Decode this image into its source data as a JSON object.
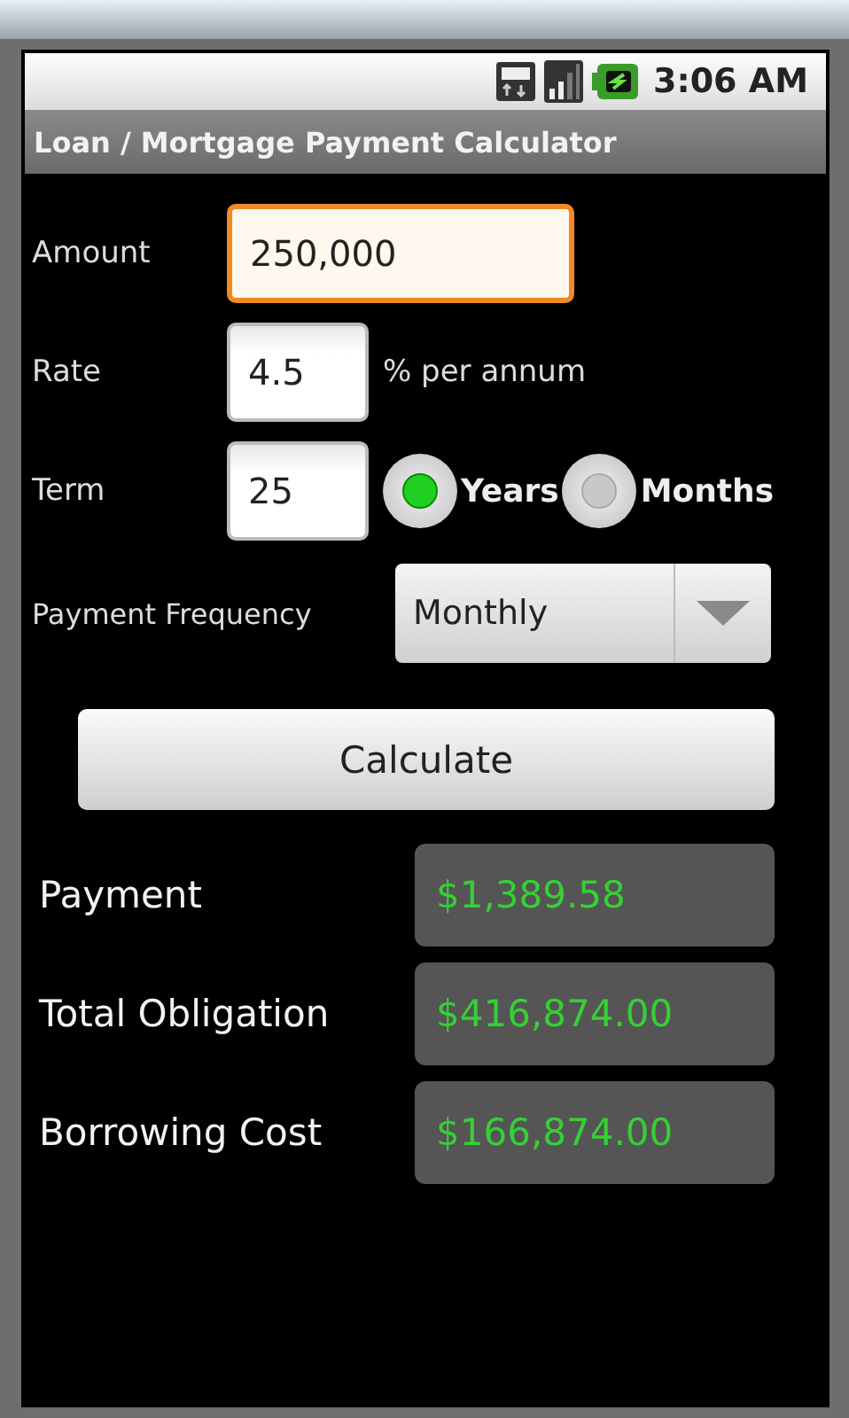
{
  "status_bar": {
    "time": "3:06 AM"
  },
  "title": "Loan / Mortgage Payment Calculator",
  "amount": {
    "label": "Amount",
    "value": "250,000",
    "focused": true
  },
  "rate": {
    "label": "Rate",
    "value": "4.5",
    "focused": false,
    "suffix": "% per annum"
  },
  "term": {
    "label": "Term",
    "value": "25",
    "focused": false
  },
  "term_units": [
    {
      "label": "Years",
      "selected": true
    },
    {
      "label": "Months",
      "selected": false
    }
  ],
  "frequency": {
    "label": "Payment Frequency",
    "value": "Monthly"
  },
  "calculate_button": "Calculate",
  "results": [
    {
      "label": "Payment",
      "value": "$1,389.58"
    },
    {
      "label": "Total Obligation",
      "value": "$416,874.00"
    },
    {
      "label": "Borrowing Cost",
      "value": "$166,874.00"
    }
  ]
}
